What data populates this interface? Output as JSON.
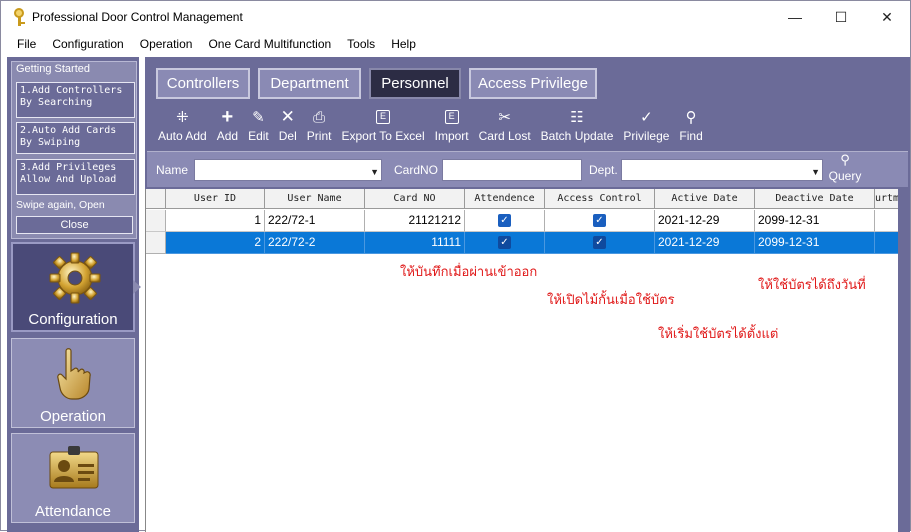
{
  "window": {
    "title": "Professional Door Control Management",
    "minimize": "—",
    "maximize": "☐",
    "close": "✕"
  },
  "menu": [
    "File",
    "Configuration",
    "Operation",
    "One Card Multifunction",
    "Tools",
    "Help"
  ],
  "getting_started": {
    "title": "Getting Started",
    "step1": "1.Add Controllers By Searching",
    "step2": "2.Auto Add Cards By Swiping",
    "step3": "3.Add Privileges Allow And Upload",
    "swipe_again": "Swipe again, Open",
    "close": "Close"
  },
  "nav": {
    "configuration": "Configuration",
    "operation": "Operation",
    "attendance": "Attendance"
  },
  "tabs": [
    "Controllers",
    "Department",
    "Personnel",
    "Access Privilege"
  ],
  "active_tab": "Personnel",
  "toolbar": {
    "auto_add": "Auto Add",
    "add": "Add",
    "edit": "Edit",
    "del": "Del",
    "print": "Print",
    "export": "Export To Excel",
    "import": "Import",
    "card_lost": "Card Lost",
    "batch_update": "Batch Update",
    "privilege": "Privilege",
    "find": "Find"
  },
  "filter": {
    "name_label": "Name",
    "name_value": "",
    "cardno_label": "CardNO",
    "cardno_value": "",
    "dept_label": "Dept.",
    "dept_value": "",
    "query": "Query"
  },
  "grid": {
    "columns": [
      "User ID",
      "User Name",
      "Card NO",
      "Attendence",
      "Access Control",
      "Active Date",
      "Deactive Date",
      "urtm"
    ],
    "rows": [
      {
        "user_id": "1",
        "user_name": "222/72-1",
        "card_no": "21121212",
        "attendence": true,
        "access_control": true,
        "active_date": "2021-12-29",
        "deactive_date": "2099-12-31"
      },
      {
        "user_id": "2",
        "user_name": "222/72-2",
        "card_no": "11111",
        "attendence": true,
        "access_control": true,
        "active_date": "2021-12-29",
        "deactive_date": "2099-12-31"
      }
    ],
    "selected_row": 1
  },
  "annotations": {
    "attendance_note": "ให้บันทึกเมื่อผ่านเข้าออก",
    "access_note": "ให้เปิดไม้กั้นเมื่อใช้บัตร",
    "deactive_note": "ให้ใช้บัตรได้ถึงวันที่",
    "active_note": "ให้เริ่มใช้บัตรได้ตั้งแต่"
  },
  "colors": {
    "panel": "#6b6b98",
    "selected_row": "#0a78d7",
    "annotation": "#e01818"
  }
}
